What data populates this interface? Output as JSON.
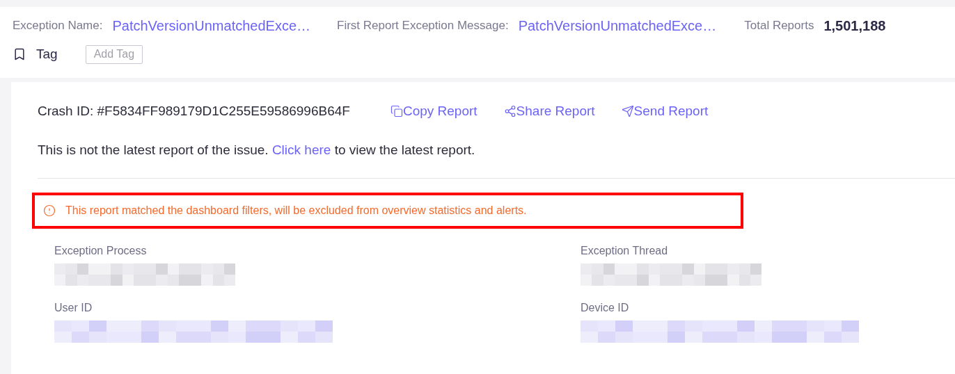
{
  "header": {
    "fields": [
      {
        "label": "Exception Name:",
        "value": "PatchVersionUnmatchedExce…",
        "kind": "link"
      },
      {
        "label": "First Report Exception Message:",
        "value": "PatchVersionUnmatchedExce…",
        "kind": "link"
      },
      {
        "label": "Total Reports",
        "value": "1,501,188",
        "kind": "number"
      }
    ],
    "tag": {
      "label": "Tag",
      "button": "Add Tag"
    }
  },
  "report": {
    "crash_id": "Crash ID: #F5834FF989179D1C255E59586996B64F",
    "actions": [
      {
        "label": "Copy Report",
        "kind": "copy"
      },
      {
        "label": "Share Report",
        "kind": "share"
      },
      {
        "label": "Send Report",
        "kind": "send"
      }
    ],
    "notice": {
      "before": "This is not the latest report of the issue.",
      "link": "Click here",
      "after": "to view the latest report."
    },
    "warning": {
      "text": "This report matched the dashboard filters, will be excluded from overview statistics and alerts.",
      "highlighted": true
    },
    "fields": [
      {
        "label": "Exception Process",
        "kind": "plain"
      },
      {
        "label": "Exception Thread",
        "kind": "plain"
      },
      {
        "label": "User ID",
        "kind": "link"
      },
      {
        "label": "Device ID",
        "kind": "link"
      }
    ]
  }
}
